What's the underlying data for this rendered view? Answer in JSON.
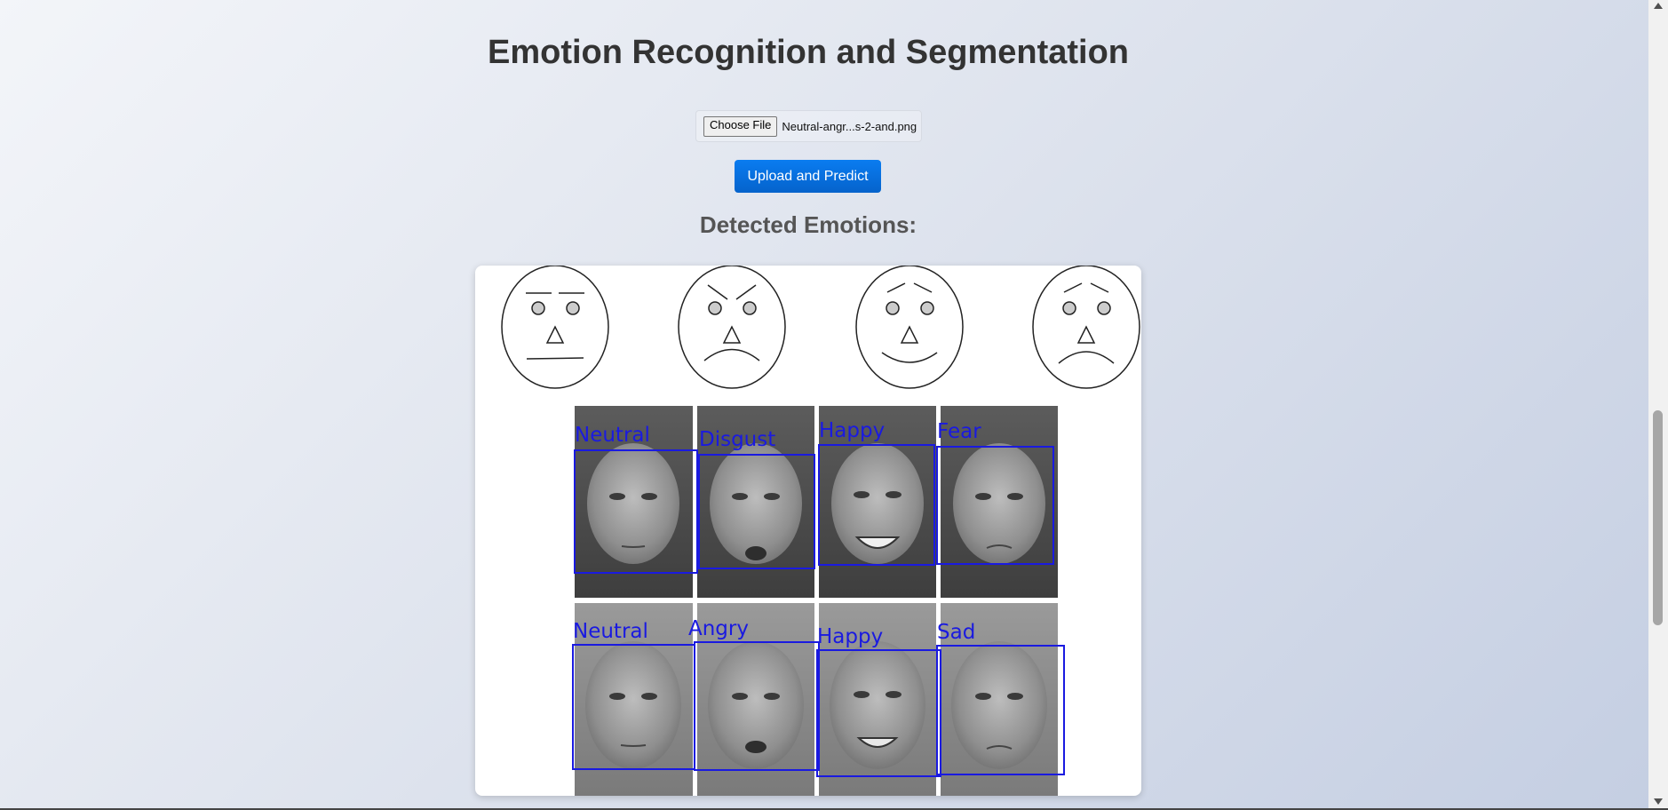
{
  "header": {
    "title": "Emotion Recognition and Segmentation"
  },
  "upload": {
    "choose_file_label": "Choose File",
    "file_name": "Neutral-angr...s-2-and.png",
    "submit_label": "Upload and Predict"
  },
  "results": {
    "heading": "Detected Emotions:",
    "cartoon_faces": [
      "neutral",
      "angry",
      "happy",
      "sad"
    ],
    "detections": [
      {
        "label": "Neutral"
      },
      {
        "label": "Disgust"
      },
      {
        "label": "Happy"
      },
      {
        "label": "Fear"
      },
      {
        "label": "Neutral"
      },
      {
        "label": "Angry"
      },
      {
        "label": "Happy"
      },
      {
        "label": "Sad"
      }
    ]
  },
  "colors": {
    "box": "#1a1ae0",
    "button": "#0a6fe0",
    "title": "#333333"
  }
}
